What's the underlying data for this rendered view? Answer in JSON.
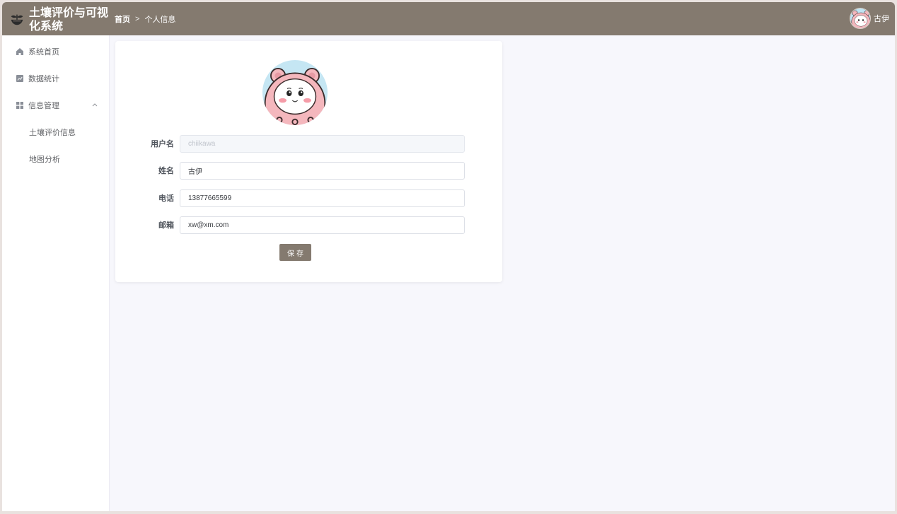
{
  "header": {
    "app_title": "土壤评价与可视化系统",
    "breadcrumb": {
      "home": "首页",
      "separator": ">",
      "current": "个人信息"
    },
    "user_name": "古伊"
  },
  "sidebar": {
    "items": [
      {
        "label": "系统首页",
        "icon": "home-icon"
      },
      {
        "label": "数据统计",
        "icon": "chart-icon"
      },
      {
        "label": "信息管理",
        "icon": "grid-icon",
        "expanded": true
      }
    ],
    "submenu": [
      {
        "label": "土壤评价信息"
      },
      {
        "label": "地图分析"
      }
    ]
  },
  "profile_form": {
    "username": {
      "label": "用户名",
      "value": "chiikawa"
    },
    "name": {
      "label": "姓名",
      "value": "古伊"
    },
    "phone": {
      "label": "电话",
      "value": "13877665599"
    },
    "email": {
      "label": "邮箱",
      "value": "xw@xm.com"
    },
    "save_label": "保存"
  },
  "colors": {
    "accent": "#847a6f",
    "background": "#f7f7fc"
  }
}
